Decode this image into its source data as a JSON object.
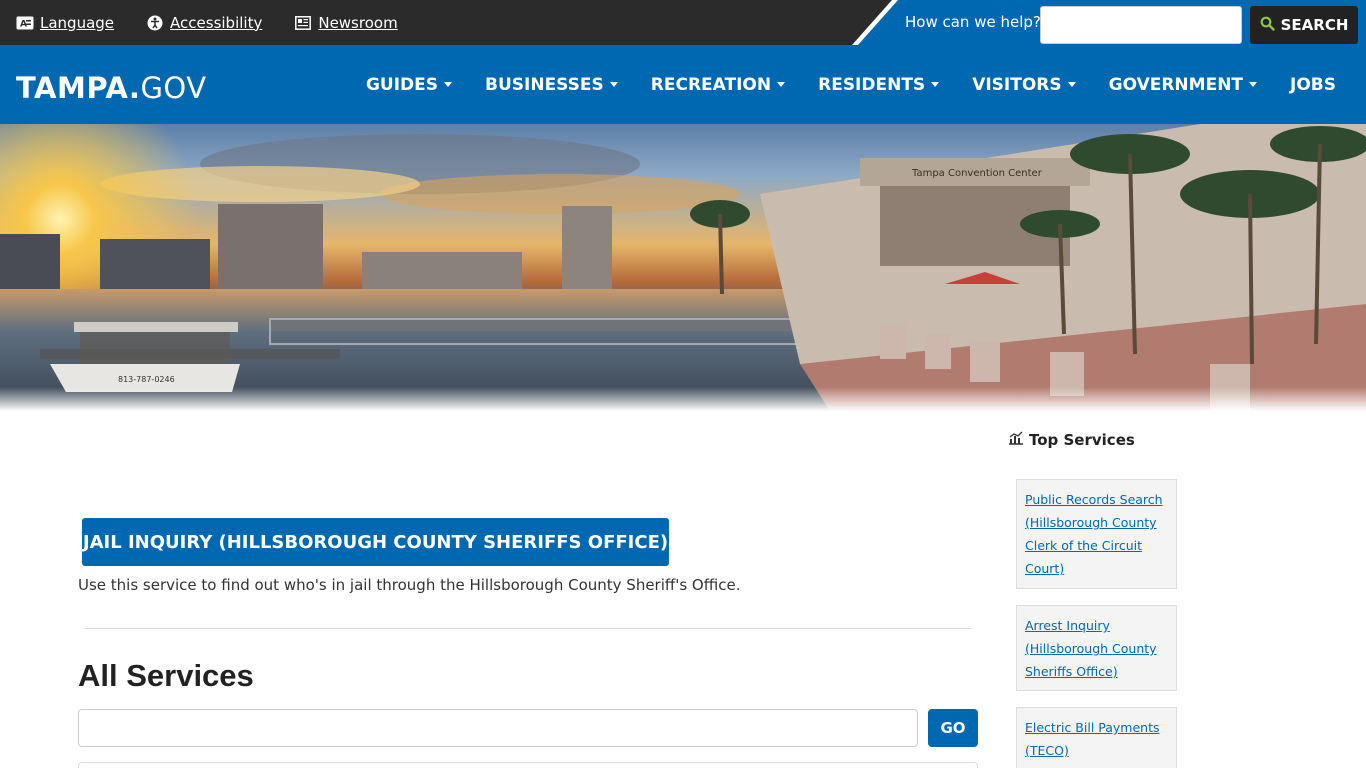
{
  "utility": {
    "links": [
      {
        "label": "Language",
        "icon": "language-icon"
      },
      {
        "label": "Accessibility",
        "icon": "accessibility-icon"
      },
      {
        "label": "Newsroom",
        "icon": "newspaper-icon"
      }
    ],
    "help_label": "How can we help?",
    "search_label": "SEARCH"
  },
  "nav": {
    "logo_bold": "TAMPA.",
    "logo_rest": "GOV",
    "items": [
      {
        "label": "GUIDES",
        "dropdown": true
      },
      {
        "label": "BUSINESSES",
        "dropdown": true
      },
      {
        "label": "RECREATION",
        "dropdown": true
      },
      {
        "label": "RESIDENTS",
        "dropdown": true
      },
      {
        "label": "VISITORS",
        "dropdown": true
      },
      {
        "label": "GOVERNMENT",
        "dropdown": true
      },
      {
        "label": "JOBS",
        "dropdown": false
      }
    ]
  },
  "hero": {
    "sign_text": "Tampa Convention Center",
    "boat_text": "813-787-0246"
  },
  "main": {
    "feature_button": "JAIL INQUIRY (HILLSBOROUGH COUNTY SHERIFFS OFFICE)",
    "feature_desc": "Use this service to find out who's in jail through the Hillsborough County Sheriff's Office.",
    "all_services_title": "All Services",
    "go_label": "GO"
  },
  "sidebar": {
    "title": "Top Services",
    "services": [
      {
        "line1": "Public Records Search",
        "line2": "(Hillsborough County",
        "line3": "Clerk of the Circuit",
        "line4": "Court)"
      },
      {
        "line1": "Arrest Inquiry",
        "line2": "(Hillsborough County",
        "line3": "Sheriffs Office)"
      },
      {
        "line1": "Electric Bill Payments",
        "line2": "(TECO)"
      }
    ]
  },
  "colors": {
    "brand_blue": "#0067b1",
    "utility_dark": "#2b2b2b",
    "search_icon_green": "#8bc34a"
  }
}
